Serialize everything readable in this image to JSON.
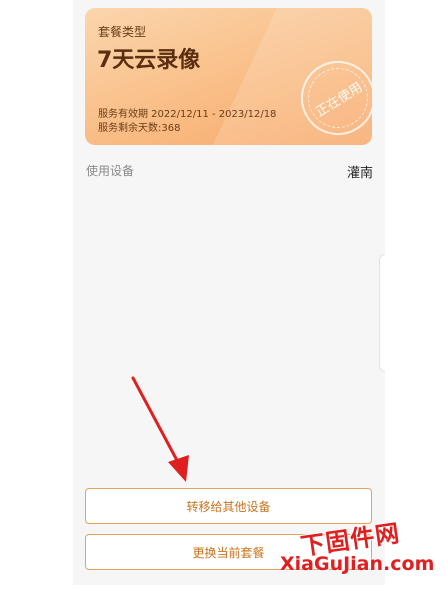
{
  "package": {
    "label": "套餐类型",
    "name": "7天云录像",
    "validity": "服务有效期  2022/12/11 - 2023/12/18",
    "remaining": "服务剩余天数:368",
    "stamp": "正在使用"
  },
  "device": {
    "label": "使用设备",
    "value": "灌南"
  },
  "buttons": {
    "transfer": "转移给其他设备",
    "change": "更换当前套餐"
  },
  "watermark": {
    "cn": "下固件网",
    "en": "XiaGuJian.com"
  },
  "colors": {
    "accent": "#c9741f",
    "card_gradient_start": "#fbd6ad",
    "card_gradient_end": "#f7a86a",
    "arrow": "#e02020"
  }
}
